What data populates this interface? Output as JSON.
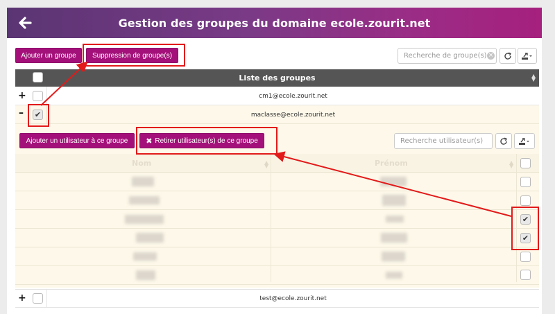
{
  "header": {
    "title": "Gestion des groupes du domaine ecole.zourit.net"
  },
  "toolbar": {
    "add_group_label": "Ajouter un groupe",
    "delete_groups_label": "Suppression de groupe(s)",
    "search_placeholder": "Recherche de groupe(s)"
  },
  "groups_table": {
    "header": "Liste des groupes",
    "rows": [
      {
        "expander": "+",
        "email": "cm1@ecole.zourit.net",
        "checked": false
      },
      {
        "expander": "–",
        "email": "maclasse@ecole.zourit.net",
        "checked": true
      },
      {
        "expander": "+",
        "email": "test@ecole.zourit.net",
        "checked": false
      }
    ]
  },
  "members": {
    "add_user_label": "Ajouter un utilisateur à ce groupe",
    "remove_users_label": "Retirer utilisateur(s) de ce groupe",
    "search_placeholder": "Recherche utilisateur(s)",
    "columns": [
      "Nom",
      "Prénom"
    ],
    "rows_checked": [
      false,
      false,
      true,
      true,
      false,
      false
    ]
  },
  "icons": {
    "back": "arrow-left-icon",
    "refresh": "refresh-icon",
    "export": "export-icon",
    "remove": "times-icon"
  },
  "colors": {
    "accent": "#a4107a",
    "header_start": "#5a3573",
    "header_end": "#a6207e",
    "annotation": "#e21a1a"
  }
}
